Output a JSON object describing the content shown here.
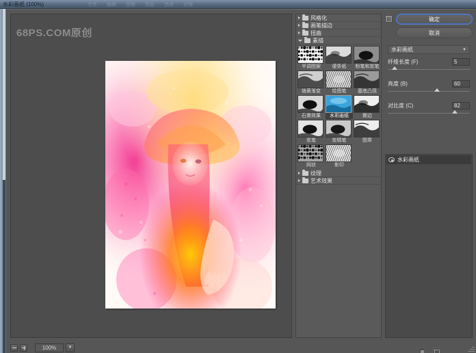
{
  "window": {
    "title": "水彩画纸 (100%)",
    "ghost_menu": [
      "文件",
      "编辑",
      "图像",
      "图层",
      "选择",
      "滤镜"
    ]
  },
  "preview": {
    "watermark": "68PS.COM原创",
    "zoom_level": "100%",
    "zoom_out_icon": "zoom-out-icon",
    "zoom_in_icon": "zoom-in-icon",
    "dropdown_icon": "chevron-down-icon",
    "artwork_alt": "watercolor portrait of woman with hat"
  },
  "filters": {
    "categories": [
      {
        "label": "风格化",
        "open": false
      },
      {
        "label": "画笔描边",
        "open": false
      },
      {
        "label": "扭曲",
        "open": false
      },
      {
        "label": "素描",
        "open": true
      }
    ],
    "tail_categories": [
      {
        "label": "纹理",
        "open": false
      },
      {
        "label": "艺术效果",
        "open": false
      }
    ],
    "thumbnails": [
      {
        "label": "半调图案",
        "selected": false,
        "style": "halftone"
      },
      {
        "label": "便条纸",
        "selected": false,
        "style": "notepaper"
      },
      {
        "label": "粉笔和炭笔",
        "selected": false,
        "style": "chalkcharcoal"
      },
      {
        "label": "铬黄渐变",
        "selected": false,
        "style": "chrome"
      },
      {
        "label": "绘图笔",
        "selected": false,
        "style": "graphicpen"
      },
      {
        "label": "基底凸现",
        "selected": false,
        "style": "basrelief"
      },
      {
        "label": "石膏效果",
        "selected": false,
        "style": "plaster"
      },
      {
        "label": "水彩画纸",
        "selected": true,
        "style": "waterpaper"
      },
      {
        "label": "撕边",
        "selected": false,
        "style": "tornedges"
      },
      {
        "label": "炭笔",
        "selected": false,
        "style": "charcoal"
      },
      {
        "label": "炭精笔",
        "selected": false,
        "style": "conte"
      },
      {
        "label": "图章",
        "selected": false,
        "style": "stamp"
      },
      {
        "label": "网状",
        "selected": false,
        "style": "reticulation"
      },
      {
        "label": "影印",
        "selected": false,
        "style": "photocopy"
      }
    ]
  },
  "settings": {
    "ok_label": "确定",
    "cancel_label": "取消",
    "preset_icon": "preset-menu-icon",
    "selected_filter": "水彩画纸",
    "chevron": "▾",
    "sliders": [
      {
        "label": "纤维长度 (F)",
        "value": "5",
        "percent": 8
      },
      {
        "label": "亮度 (B)",
        "value": "60",
        "percent": 60
      },
      {
        "label": "对比度 (C)",
        "value": "82",
        "percent": 82
      }
    ]
  },
  "effects": {
    "visibility_icon": "eye-icon",
    "layer_name": "水彩画纸",
    "new_effect_icon": "new-effect-layer-icon",
    "delete_icon": "trash-icon"
  },
  "colors": {
    "dialog_bg": "#565656",
    "panel_bg": "#5a5a5a",
    "accent": "#3f6ab8",
    "titlebar": "#64798f"
  }
}
